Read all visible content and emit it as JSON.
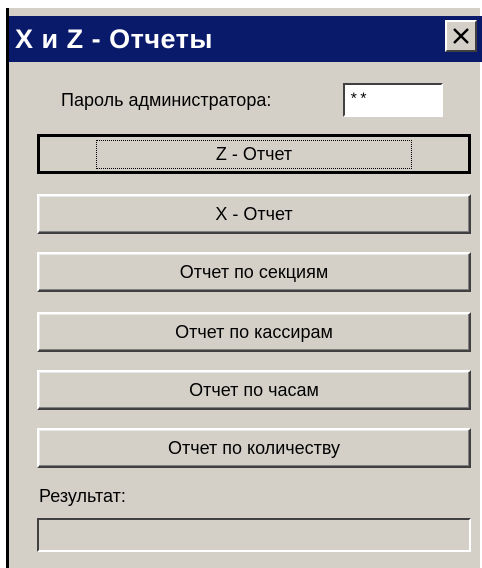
{
  "window": {
    "title": "X и Z - Отчеты"
  },
  "password": {
    "label": "Пароль администратора:",
    "value": "**"
  },
  "buttons": {
    "z_report": "Z - Отчет",
    "x_report": "X - Отчет",
    "sections_report": "Отчет по секциям",
    "cashiers_report": "Отчет по кассирам",
    "hours_report": "Отчет по часам",
    "quantity_report": "Отчет по количеству"
  },
  "result": {
    "label": "Результат:",
    "value": ""
  },
  "icons": {
    "close": "close-icon"
  }
}
